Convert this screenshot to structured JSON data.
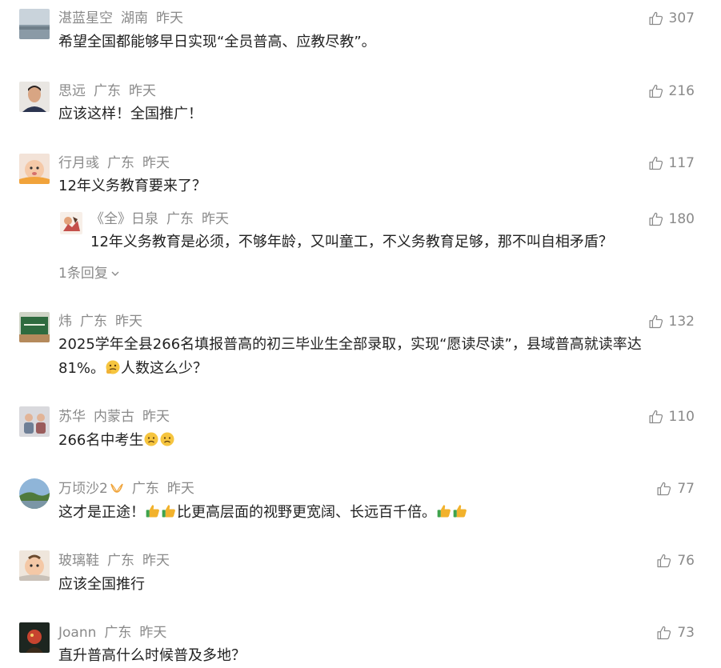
{
  "comments": [
    {
      "user": "湛蓝星空",
      "region": "湖南",
      "time": "昨天",
      "text": "希望全国都能够早日实现“全员普高、应教尽教”。",
      "likes": "307"
    },
    {
      "user": "思远",
      "region": "广东",
      "time": "昨天",
      "text": "应该这样！全国推广！",
      "likes": "216"
    },
    {
      "user": "行月彧",
      "region": "广东",
      "time": "昨天",
      "text": "12年义务教育要来了？",
      "likes": "117",
      "reply": {
        "user": "《全》日泉",
        "region": "广东",
        "time": "昨天",
        "text": "12年义务教育是必须，不够年龄，又叫童工，不义务教育足够，那不叫自相矛盾？",
        "likes": "180"
      },
      "replies_label": "1条回复"
    },
    {
      "user": "炜",
      "region": "广东",
      "time": "昨天",
      "text_line1": "2025学年全县266名填报普高的初三毕业生全部录取，实现“愿读尽读”，县域普高就读率达",
      "text_line2_a": "81%。",
      "text_line2_b": "人数这么少？",
      "likes": "132"
    },
    {
      "user": "苏华",
      "region": "内蒙古",
      "time": "昨天",
      "text": "266名中考生",
      "likes": "110"
    },
    {
      "user": "万顷沙2",
      "region": "广东",
      "time": "昨天",
      "text_a": "这才是正途！",
      "text_b": "比更高层面的视野更宽阔、长远百千倍。",
      "likes": "77"
    },
    {
      "user": "玻璃鞋",
      "region": "广东",
      "time": "昨天",
      "text": "应该全国推行",
      "likes": "76"
    },
    {
      "user": "Joann",
      "region": "广东",
      "time": "昨天",
      "text": "直升普高什么时候普及多地？",
      "likes": "73"
    }
  ],
  "icons": {
    "like": "thumbs-up-icon",
    "expand": "chevron-down-icon"
  },
  "colors": {
    "meta": "#8a8a8a",
    "text": "#222222"
  }
}
